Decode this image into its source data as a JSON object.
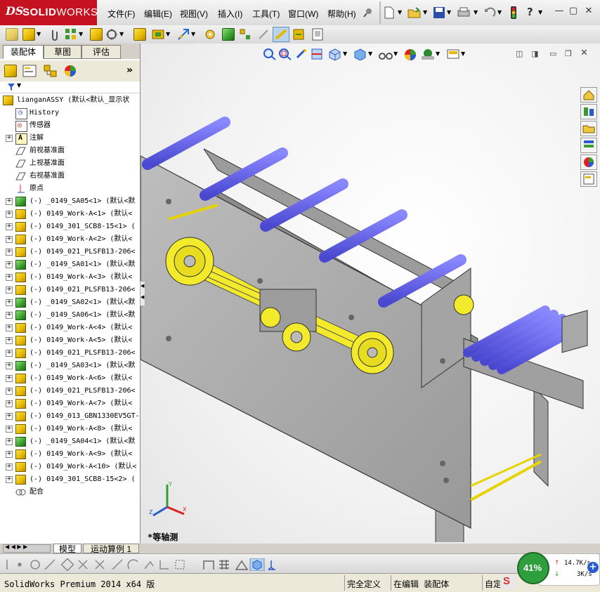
{
  "app": {
    "logo_ds": "DS",
    "logo_solid": "SOLID",
    "logo_works": "WORKS"
  },
  "menu": {
    "items": [
      "文件(F)",
      "编辑(E)",
      "视图(V)",
      "插入(I)",
      "工具(T)",
      "窗口(W)",
      "帮助(H)"
    ]
  },
  "left_panel": {
    "tabs": [
      "装配体",
      "草图",
      "评估"
    ],
    "expand_label": "»",
    "tree": [
      {
        "label": "lianganASSY  (默认<默认_显示状",
        "icon": "assembly",
        "expand": false,
        "indent": 0
      },
      {
        "label": "History",
        "icon": "history",
        "expand": false,
        "indent": 1
      },
      {
        "label": "传感器",
        "icon": "sensor",
        "expand": false,
        "indent": 1
      },
      {
        "label": "注解",
        "icon": "annotation",
        "expand": true,
        "indent": 1
      },
      {
        "label": "前视基准面",
        "icon": "plane",
        "expand": false,
        "indent": 1
      },
      {
        "label": "上视基准面",
        "icon": "plane",
        "expand": false,
        "indent": 1
      },
      {
        "label": "右视基准面",
        "icon": "plane",
        "expand": false,
        "indent": 1
      },
      {
        "label": "原点",
        "icon": "origin",
        "expand": false,
        "indent": 1
      },
      {
        "label": "(-) _0149_SA05<1> (默认<默",
        "icon": "sub-green",
        "expand": true,
        "indent": 1
      },
      {
        "label": "(-) 0149_Work-A<1> (默认<",
        "icon": "part",
        "expand": true,
        "indent": 1
      },
      {
        "label": "(-) 0149_301_SCB8-15<1> (",
        "icon": "part",
        "expand": true,
        "indent": 1
      },
      {
        "label": "(-) 0149_Work-A<2> (默认<",
        "icon": "part",
        "expand": true,
        "indent": 1
      },
      {
        "label": "(-) 0149_021_PLSFB13-206<",
        "icon": "part",
        "expand": true,
        "indent": 1
      },
      {
        "label": "(-) _0149_SA01<1> (默认<默",
        "icon": "sub-green",
        "expand": true,
        "indent": 1
      },
      {
        "label": "(-) 0149_Work-A<3> (默认<",
        "icon": "part",
        "expand": true,
        "indent": 1
      },
      {
        "label": "(-) 0149_021_PLSFB13-206<",
        "icon": "part",
        "expand": true,
        "indent": 1
      },
      {
        "label": "(-) _0149_SA02<1> (默认<默",
        "icon": "sub-green",
        "expand": true,
        "indent": 1
      },
      {
        "label": "(-) _0149_SA06<1> (默认<默",
        "icon": "sub-green",
        "expand": true,
        "indent": 1
      },
      {
        "label": "(-) 0149_Work-A<4> (默认<",
        "icon": "part",
        "expand": true,
        "indent": 1
      },
      {
        "label": "(-) 0149_Work-A<5> (默认<",
        "icon": "part",
        "expand": true,
        "indent": 1
      },
      {
        "label": "(-) 0149_021_PLSFB13-206<",
        "icon": "part",
        "expand": true,
        "indent": 1
      },
      {
        "label": "(-) _0149_SA03<1> (默认<默",
        "icon": "sub-green",
        "expand": true,
        "indent": 1
      },
      {
        "label": "(-) 0149_Work-A<6> (默认<",
        "icon": "part",
        "expand": true,
        "indent": 1
      },
      {
        "label": "(-) 0149_021_PLSFB13-206<",
        "icon": "part",
        "expand": true,
        "indent": 1
      },
      {
        "label": "(-) 0149_Work-A<7> (默认<",
        "icon": "part",
        "expand": true,
        "indent": 1
      },
      {
        "label": "(-) 0149_013_GBN1330EV5GT-",
        "icon": "part",
        "expand": true,
        "indent": 1
      },
      {
        "label": "(-) 0149_Work-A<8> (默认<",
        "icon": "part",
        "expand": true,
        "indent": 1
      },
      {
        "label": "(-) _0149_SA04<1> (默认<默",
        "icon": "sub-green",
        "expand": true,
        "indent": 1
      },
      {
        "label": "(-) 0149_Work-A<9> (默认<",
        "icon": "part",
        "expand": true,
        "indent": 1
      },
      {
        "label": "(-) 0149_Work-A<10> (默认<",
        "icon": "part",
        "expand": true,
        "indent": 1
      },
      {
        "label": "(-) 0149_301_SCB8-15<2> (",
        "icon": "part",
        "expand": true,
        "indent": 1
      },
      {
        "label": "配合",
        "icon": "mates",
        "expand": false,
        "indent": 1
      }
    ],
    "bottom_tabs": [
      "模型",
      "运动算例 1"
    ]
  },
  "viewport": {
    "view_name": "*等轴测"
  },
  "status_bar": {
    "product": "SolidWorks Premium 2014 x64 版",
    "state": "完全定义",
    "mode": "在编辑 装配体",
    "custom": "自定"
  },
  "net_widget": {
    "percent": "41%",
    "up": "14.7K/s",
    "down": "3K/s",
    "up_arrow": "↑",
    "down_arrow": "↓",
    "percent_value": 41
  },
  "colors": {
    "logo_red": "#c41220",
    "roller_blue": "#6e6cf0",
    "pulley_yellow": "#f2ea2a",
    "frame_gray": "#a8a8a8",
    "widget_green": "#2f9e3c"
  }
}
